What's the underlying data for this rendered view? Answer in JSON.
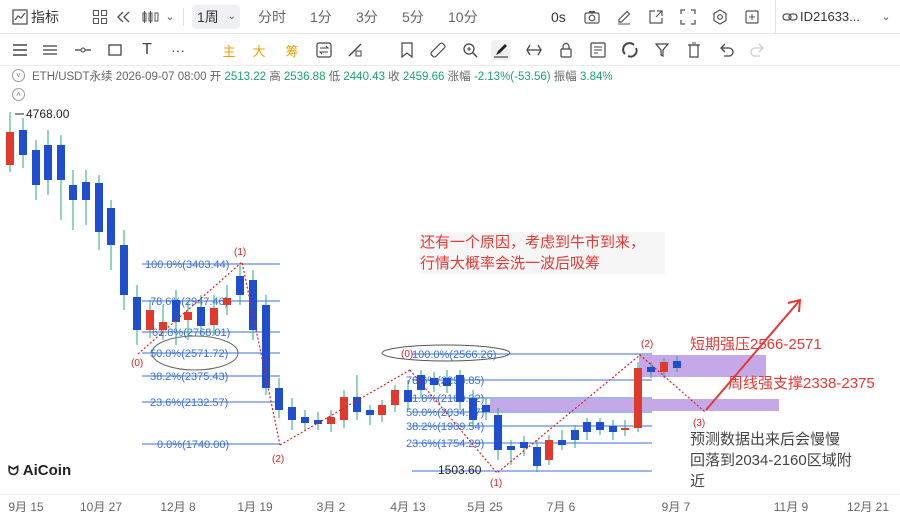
{
  "topbar": {
    "indicator_label": "指标",
    "period_selected": "1周",
    "periods": [
      "分时",
      "1分",
      "3分",
      "5分",
      "10分"
    ],
    "countdown": "0s",
    "account_id": "ID21633..."
  },
  "toolbar": {
    "main_label": "主",
    "big_label": "大",
    "chip_label": "筹"
  },
  "info": {
    "symbol": "ETH/USDT永续",
    "datetime": "2026-09-07 08:00",
    "open_label": "开",
    "open": "2513.22",
    "high_label": "高",
    "high": "2536.88",
    "low_label": "低",
    "low": "2440.43",
    "close_label": "收",
    "close": "2459.66",
    "change_label": "涨幅",
    "change": "-2.13%(-53.56)",
    "amplitude_label": "振幅",
    "amplitude": "3.84%"
  },
  "chart_data": {
    "type": "candlestick",
    "high_marker": "4768.00",
    "low_marker": "1503.60",
    "x_ticks": [
      "9月 15",
      "10月 27",
      "12月 8",
      "1月 19",
      "3月 2",
      "4月 13",
      "5月 25",
      "7月 6",
      "9月 7",
      "11月 9",
      "12月 21"
    ],
    "fib_left": [
      "100.0%(3403.44)",
      "78.6%(2947.46)",
      "61.8%(2768.01)",
      "50.0%(2571.72)",
      "38.2%(2375.43)",
      "23.6%(2132.57)",
      "0.0%(1740.00)"
    ],
    "fib_right": [
      "100.0%(2566.26)",
      "78.6%(2298.85)",
      "61.8%(2160.32)",
      "50.0%(2034.97)",
      "38.2%(1909.54)",
      "23.6%(1754.29)",
      "0.0%(1503.60)"
    ],
    "wave_labels": [
      "(0)",
      "(1)",
      "(2)",
      "(0)",
      "(1)",
      "(2)",
      "(3)"
    ],
    "annotation_main": [
      "还有一个原因，考虑到牛市到来，",
      "行情大概率会洗一波后吸筹"
    ],
    "resistance": "短期强压2566-2571",
    "support": "周线强支撑2338-2375",
    "prediction": [
      "预测数据出来后会慢慢",
      "回落到2034-2160区域附",
      "近"
    ]
  },
  "brand": "AiCoin",
  "colors": {
    "up": "#e03a2f",
    "down": "#1f4fcf",
    "fib": "#3b6fd8",
    "wave": "#d62222",
    "zone": "#b08be0"
  }
}
